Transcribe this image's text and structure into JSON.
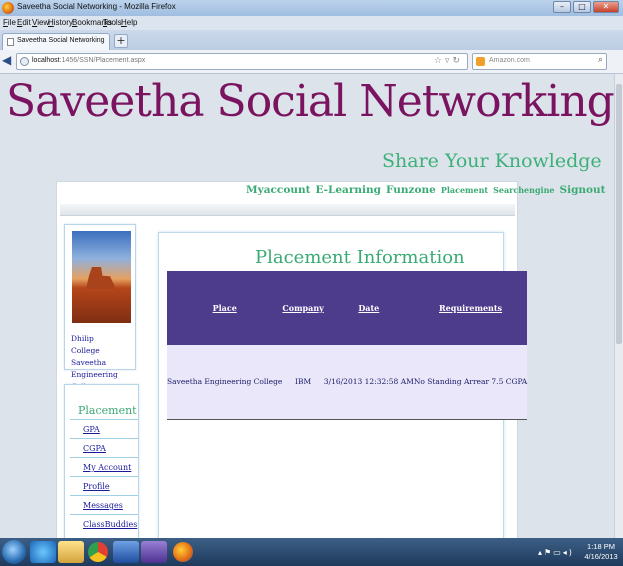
{
  "window": {
    "title": "Saveetha Social Networking - Mozilla Firefox",
    "buttons": [
      "–",
      "□",
      "✕"
    ]
  },
  "menu": [
    "File",
    "Edit",
    "View",
    "History",
    "Bookmarks",
    "Tools",
    "Help"
  ],
  "tab": {
    "label": "Saveetha Social Networking",
    "new_tab": "+"
  },
  "address": {
    "host": "localhost",
    "path": ":1456/SSN/Placement.aspx",
    "search_placeholder": "Amazon.com"
  },
  "site": {
    "title": "Saveetha Social Networking",
    "tagline": "Share Your Knowledge"
  },
  "nav": [
    "Myaccount",
    "E-Learning",
    "Funzone",
    "Placement",
    "Searchengine",
    "Signout"
  ],
  "profile": {
    "name": "Dhilip",
    "college": "College Saveetha Engineering College"
  },
  "sidebar": {
    "heading": "Placement",
    "links": [
      "GPA",
      "CGPA",
      "My Account",
      "Profile",
      "Messages",
      "ClassBuddies"
    ]
  },
  "panel": {
    "title": "Placement Information",
    "columns": [
      "Place",
      "Company",
      "Date",
      "Requirements"
    ],
    "rows": [
      [
        "Saveetha Engineering College",
        "IBM",
        "3/16/2013 12:32:58 AM",
        "No Standing Arrear 7.5 CGPA"
      ]
    ]
  },
  "taskbar": {
    "time": "1:18 PM",
    "date": "4/16/2013"
  }
}
